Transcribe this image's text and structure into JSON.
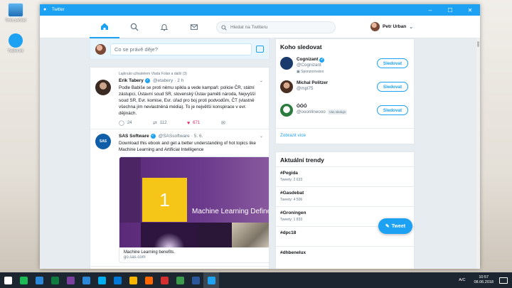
{
  "desktop": {
    "icons": [
      {
        "label": "Tento počítač"
      },
      {
        "label": "Twitter.lnk"
      }
    ]
  },
  "window": {
    "title": "Twitter",
    "controls": {
      "minimize": "–",
      "maximize": "☐",
      "close": "✕"
    }
  },
  "nav": {
    "search_placeholder": "Hledat na Twitteru",
    "user_name": "Petr Urban",
    "chevron": "⌄"
  },
  "compose": {
    "placeholder": "Co se právě děje?"
  },
  "feed": {
    "tweets": [
      {
        "context": "Lajknuto uživatelem Vlada Folan a další (3)",
        "name": "Erik Tabery",
        "handle": "@etabery",
        "time": "· 2 h",
        "text": "Podle Babiše se proti němu spikla a vede kampaň: policie ČR, státní zástupci, Ústavní soud SR, slovenský Ústav paměti národa, Nejvyšší soud SR, Evr. komise, Evr. úřad pro boj proti podvodům, ČT (vlastně všechna jím nevlastněná média). To je největší konspirace v evr. dějinách.",
        "replies": "24",
        "retweets": "112",
        "likes": "671"
      },
      {
        "avatar_text": "SAS",
        "name": "SAS Software",
        "handle": "@SASsoftware",
        "time": "· 5. 6.",
        "text": "Download this ebook and get a better understanding of hot topics like Machine Learning and Artificial Intelligence",
        "card": {
          "number": "1",
          "image_caption": "Machine Learning Defined",
          "title": "Machine Learning benefits.",
          "domain": "go.sas.com"
        }
      }
    ]
  },
  "who_to_follow": {
    "title": "Koho sledovat",
    "follow_label": "Sledovat",
    "accounts": [
      {
        "name": "Cognizant",
        "handle": "@Cognizant",
        "note": "Sponzorováno"
      },
      {
        "name": "Michal Politzer",
        "handle": "@mpl75",
        "note": ""
      },
      {
        "name": "ÓÓÓ",
        "handle": "@ooonlineooo",
        "note": "Vás sleduje"
      }
    ],
    "show_more": "Zobrazit více"
  },
  "trends": {
    "title": "Aktuální trendy",
    "items": [
      {
        "tag": "#Pegida",
        "count": "Tweety: 2 633"
      },
      {
        "tag": "#Gasdebat",
        "count": "Tweety: 4 506"
      },
      {
        "tag": "#Groningen",
        "count": "Tweety: 1 833"
      },
      {
        "tag": "#dpc18",
        "count": ""
      },
      {
        "tag": "#dhbenelux",
        "count": ""
      }
    ]
  },
  "tweet_button": "Tweet",
  "taskbar": {
    "lang": "A/C",
    "time": "10:57",
    "date": "08.06.2018",
    "app_colors": [
      "#ffffff",
      "#1db954",
      "#2b88d8",
      "#0f7b3f",
      "#7b3fa0",
      "#2b88d8",
      "#00aff0",
      "#0078d7",
      "#f4b400",
      "#ff6600",
      "#d32f2f",
      "#3c9a4b",
      "#2b579a",
      "#1da1f2"
    ]
  }
}
